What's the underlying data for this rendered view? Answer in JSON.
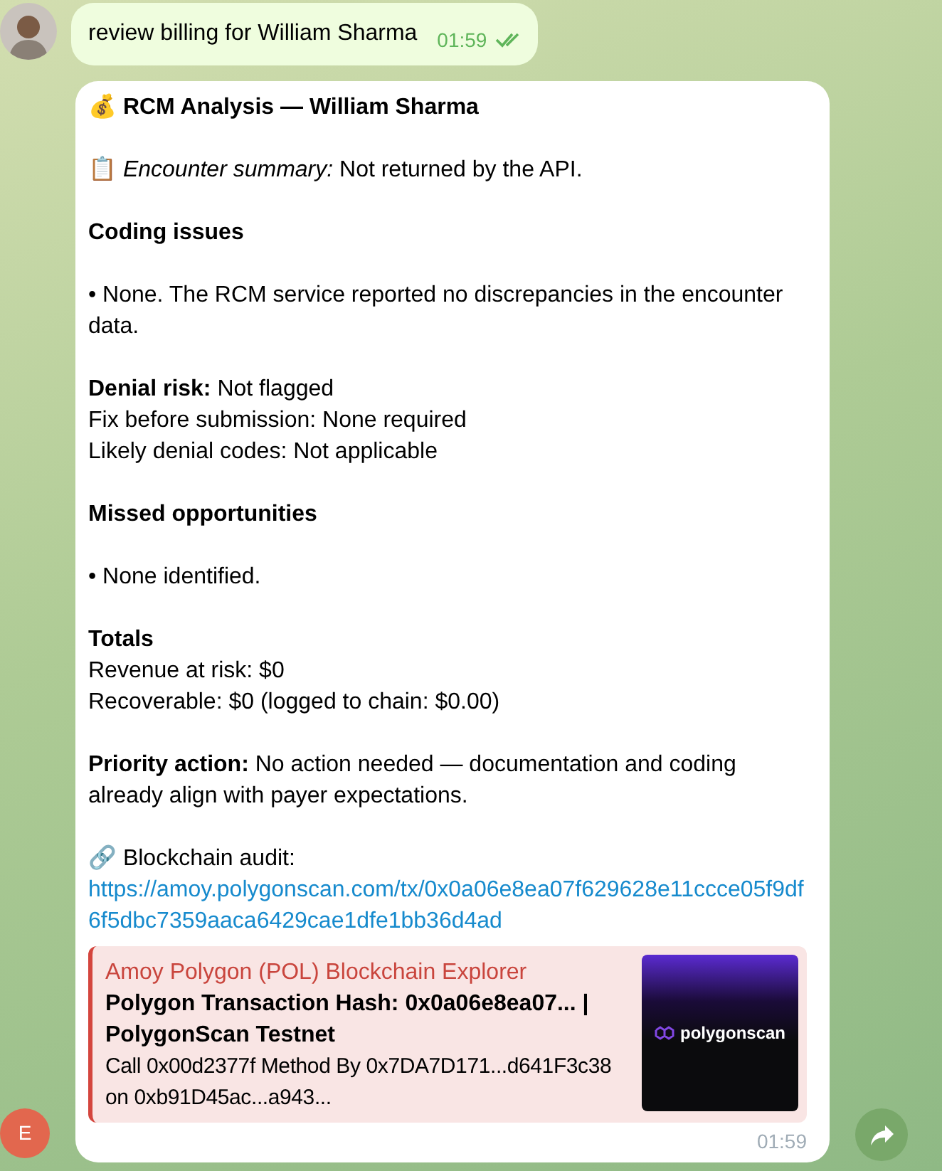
{
  "outgoing": {
    "text": "review billing for William Sharma",
    "time": "01:59",
    "read": true
  },
  "incoming": {
    "sender_initial": "E",
    "title": "💰 RCM Analysis — William Sharma",
    "blocks": [
      {
        "kind": "para",
        "lines": [
          "📋 *Encounter summary:* Not returned by the API."
        ]
      },
      {
        "kind": "heading",
        "lines": [
          "Coding issues"
        ]
      },
      {
        "kind": "para",
        "lines": [
          "• None. The RCM service reported no discrepancies in the encounter data."
        ]
      },
      {
        "kind": "para",
        "lines": [
          "**Denial risk:** Not flagged",
          "Fix before submission: None required",
          "Likely denial codes: Not applicable"
        ]
      },
      {
        "kind": "heading",
        "lines": [
          "Missed opportunities"
        ]
      },
      {
        "kind": "para",
        "lines": [
          "• None identified."
        ]
      },
      {
        "kind": "para",
        "lines": [
          "**Totals**",
          "Revenue at risk: $0",
          "Recoverable: $0 (logged to chain: $0.00)"
        ]
      },
      {
        "kind": "para",
        "lines": [
          "**Priority action:** No action needed — documentation and coding already align with payer expectations."
        ]
      },
      {
        "kind": "link",
        "lines": [
          "🔗 Blockchain audit:"
        ],
        "url": "https://amoy.polygonscan.com/tx/0x0a06e8ea07f629628e11ccce05f9df6f5dbc7359aaca6429cae1dfe1bb36d4ad"
      }
    ],
    "preview": {
      "site": "Amoy Polygon (POL) Blockchain Explorer",
      "title": "Polygon Transaction Hash: 0x0a06e8ea07... | PolygonScan Testnet",
      "description": "Call 0x00d2377f Method By 0x7DA7D171...d641F3c38 on 0xb91D45ac...a943...",
      "logo_text": "polygonscan"
    },
    "time": "01:59"
  }
}
